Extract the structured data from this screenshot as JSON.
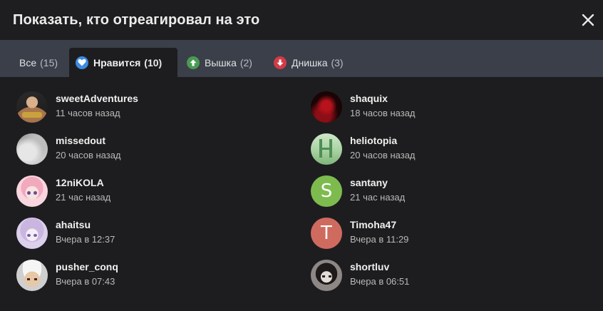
{
  "dialog": {
    "title": "Показать, кто отреагировал на это",
    "close_icon": "close-icon"
  },
  "tabs": [
    {
      "label": "Все",
      "count": "(15)",
      "icon": null
    },
    {
      "label": "Нравится",
      "count": "(10)",
      "icon": "heart-icon",
      "icon_color": "#3d8be0",
      "active": true
    },
    {
      "label": "Вышка",
      "count": "(2)",
      "icon": "arrow-up-icon",
      "icon_color": "#4a9a52"
    },
    {
      "label": "Днишка",
      "count": "(3)",
      "icon": "arrow-down-icon",
      "icon_color": "#d23b46"
    }
  ],
  "users": [
    {
      "name": "sweetAdventures",
      "time": "11 часов назад",
      "avatar": "photo"
    },
    {
      "name": "shaquix",
      "time": "18 часов назад",
      "avatar": "photo"
    },
    {
      "name": "missedout",
      "time": "20 часов назад",
      "avatar": "photo"
    },
    {
      "name": "heliotopia",
      "time": "20 часов назад",
      "avatar": "photo"
    },
    {
      "name": "12niKOLA",
      "time": "21 час назад",
      "avatar": "photo"
    },
    {
      "name": "santany",
      "time": "21 час назад",
      "avatar": "letter",
      "letter": "S",
      "color": "#7dbb4f"
    },
    {
      "name": "ahaitsu",
      "time": "Вчера в 12:37",
      "avatar": "photo"
    },
    {
      "name": "Timoha47",
      "time": "Вчера в 11:29",
      "avatar": "letter",
      "letter": "T",
      "color": "#cf6a5f"
    },
    {
      "name": "pusher_conq",
      "time": "Вчера в 07:43",
      "avatar": "photo"
    },
    {
      "name": "shortluv",
      "time": "Вчера в 06:51",
      "avatar": "photo"
    }
  ]
}
